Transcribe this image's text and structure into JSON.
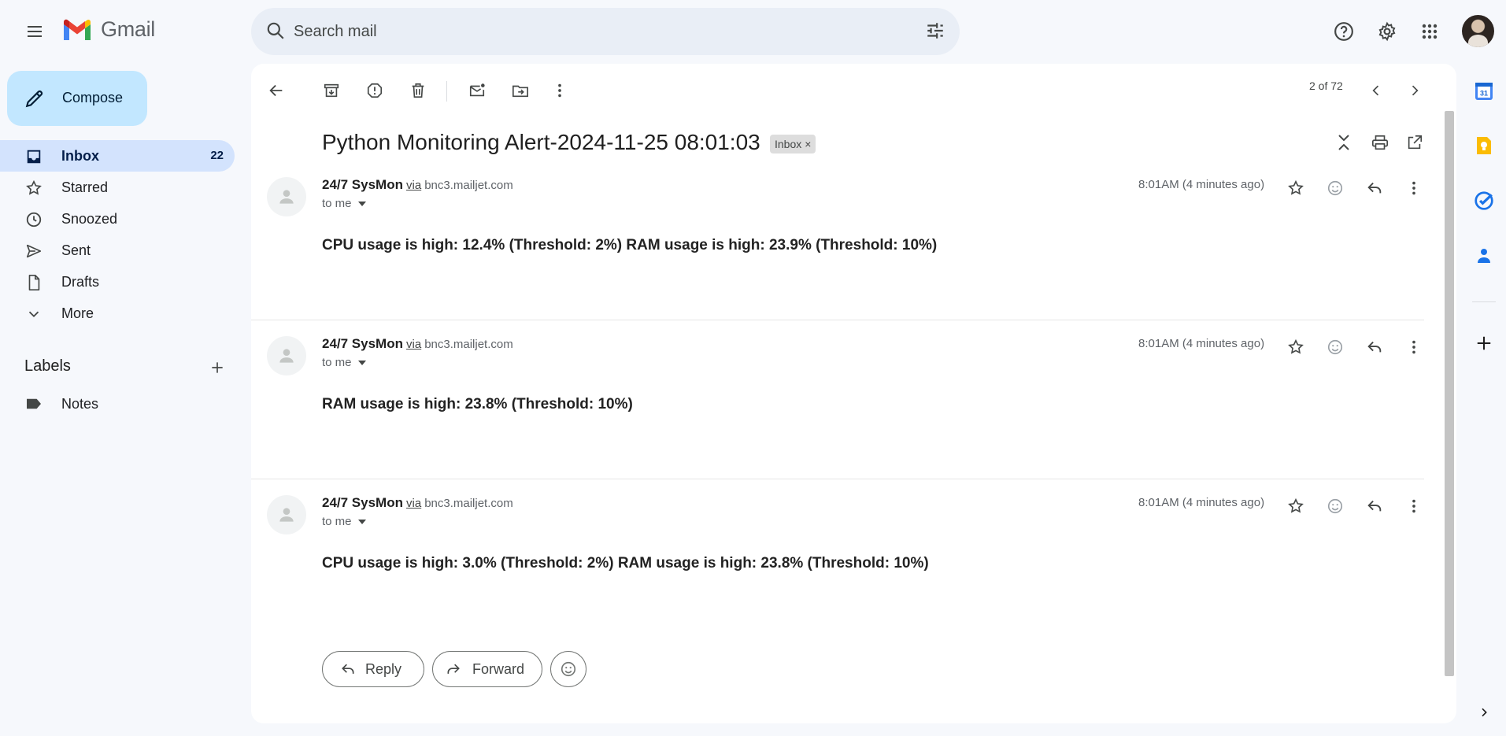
{
  "app": {
    "name": "Gmail"
  },
  "search": {
    "placeholder": "Search mail"
  },
  "sidebar": {
    "compose_label": "Compose",
    "items": [
      {
        "label": "Inbox",
        "count": "22",
        "icon": "inbox-icon",
        "active": true
      },
      {
        "label": "Starred",
        "count": "",
        "icon": "star-icon"
      },
      {
        "label": "Snoozed",
        "count": "",
        "icon": "clock-icon"
      },
      {
        "label": "Sent",
        "count": "",
        "icon": "send-icon"
      },
      {
        "label": "Drafts",
        "count": "",
        "icon": "draft-icon"
      },
      {
        "label": "More",
        "count": "",
        "icon": "chevron-down-icon"
      }
    ],
    "labels_heading": "Labels",
    "labels": [
      {
        "label": "Notes",
        "icon": "label-icon"
      }
    ]
  },
  "toolbar": {
    "pager": "2 of 72"
  },
  "thread": {
    "subject": "Python Monitoring Alert-2024-11-25 08:01:03",
    "chip": "Inbox",
    "chip_remove": "×",
    "messages": [
      {
        "sender": "24/7 SysMon",
        "via": "via",
        "domain": "bnc3.mailjet.com",
        "to": "to me",
        "time": "8:01AM (4 minutes ago)",
        "body": "CPU usage is high: 12.4% (Threshold: 2%) RAM usage is high: 23.9% (Threshold: 10%)"
      },
      {
        "sender": "24/7 SysMon",
        "via": "via",
        "domain": "bnc3.mailjet.com",
        "to": "to me",
        "time": "8:01AM (4 minutes ago)",
        "body": "RAM usage is high: 23.8% (Threshold: 10%)"
      },
      {
        "sender": "24/7 SysMon",
        "via": "via",
        "domain": "bnc3.mailjet.com",
        "to": "to me",
        "time": "8:01AM (4 minutes ago)",
        "body": "CPU usage is high: 3.0% (Threshold: 2%) RAM usage is high: 23.8% (Threshold: 10%)"
      }
    ],
    "reply_label": "Reply",
    "forward_label": "Forward"
  },
  "rail": {
    "calendar_day": "31"
  },
  "colors": {
    "accent": "#c2e7ff",
    "active_nav": "#d3e3fd",
    "background": "#f6f8fc"
  }
}
